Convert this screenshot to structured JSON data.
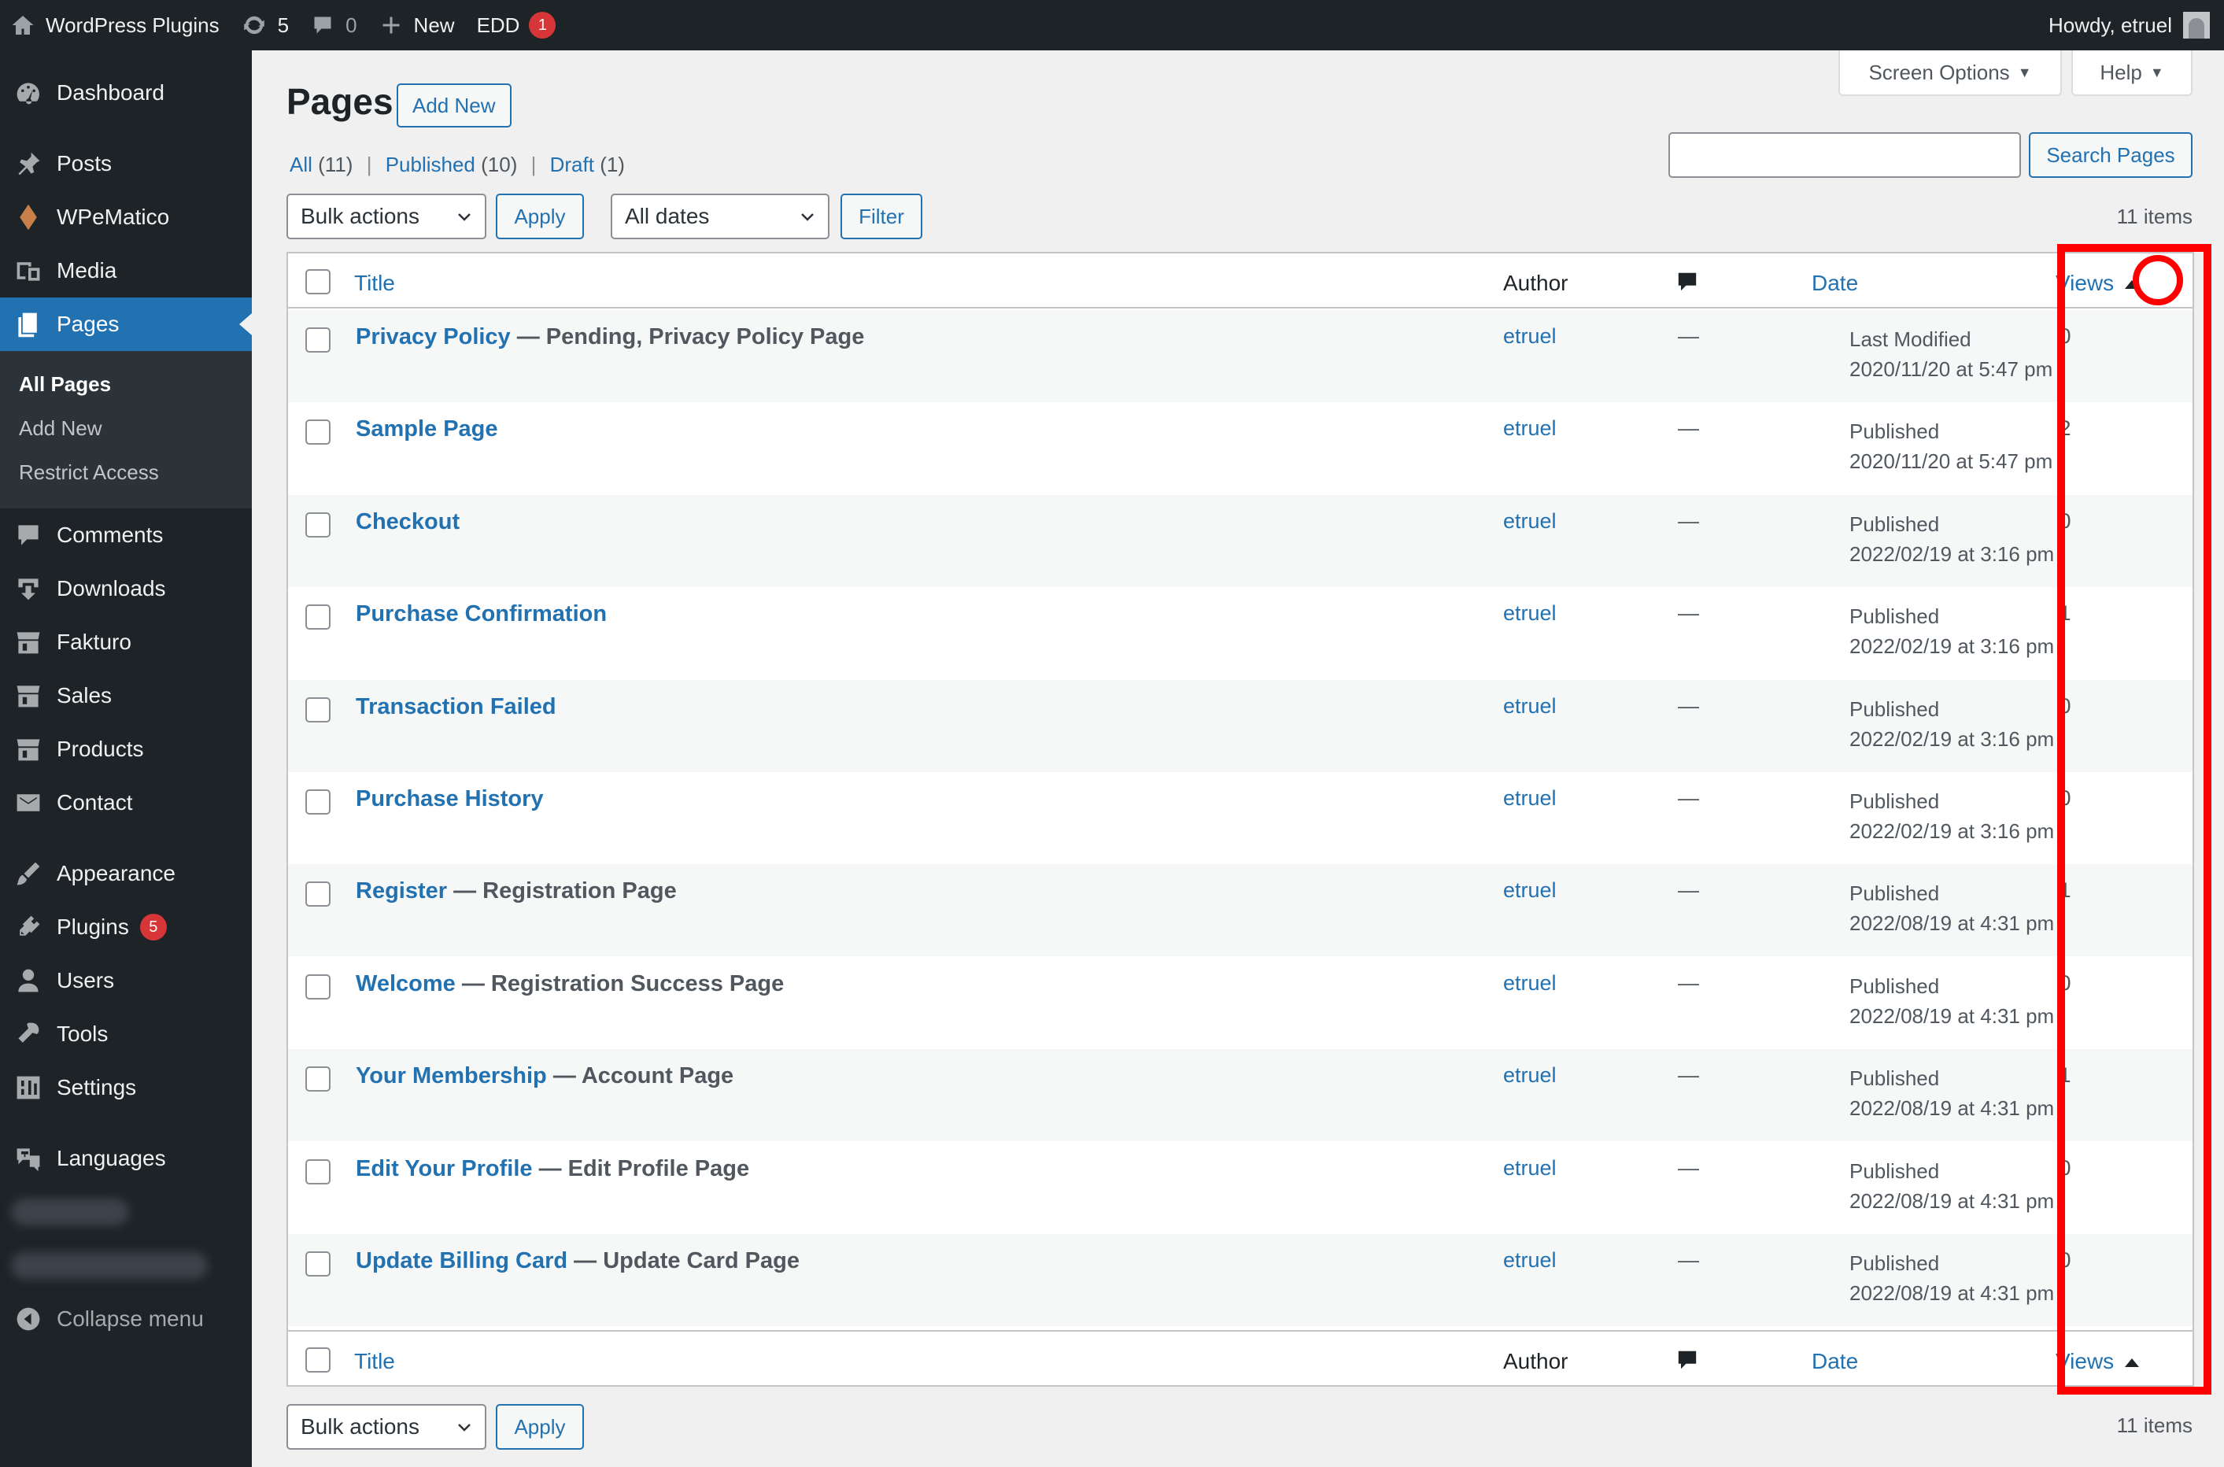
{
  "admin_bar": {
    "site_name": "WordPress Plugins",
    "updates": "5",
    "comments": "0",
    "new_label": "New",
    "edd_label": "EDD",
    "edd_badge": "1",
    "howdy": "Howdy, etruel"
  },
  "sidebar": {
    "dashboard": "Dashboard",
    "posts": "Posts",
    "wpematico": "WPeMatico",
    "media": "Media",
    "pages": "Pages",
    "sub_all_pages": "All Pages",
    "sub_add_new": "Add New",
    "sub_restrict": "Restrict Access",
    "comments": "Comments",
    "downloads": "Downloads",
    "fakturo": "Fakturo",
    "sales": "Sales",
    "products": "Products",
    "contact": "Contact",
    "appearance": "Appearance",
    "plugins": "Plugins",
    "plugins_badge": "5",
    "users": "Users",
    "tools": "Tools",
    "settings": "Settings",
    "languages": "Languages",
    "collapse": "Collapse menu"
  },
  "screen_meta": {
    "screen_options": "Screen Options",
    "help": "Help"
  },
  "header": {
    "title": "Pages",
    "add_new": "Add New"
  },
  "views_filter": {
    "all": "All",
    "all_count": "(11)",
    "published": "Published",
    "published_count": "(10)",
    "draft": "Draft",
    "draft_count": "(1)",
    "sep": "|"
  },
  "search": {
    "button": "Search Pages"
  },
  "tablenav": {
    "bulk_actions": "Bulk actions",
    "apply": "Apply",
    "all_dates": "All dates",
    "filter": "Filter",
    "items": "11 items"
  },
  "table": {
    "col_title": "Title",
    "col_author": "Author",
    "col_date": "Date",
    "col_views": "Views",
    "rows": [
      {
        "title": "Privacy Policy",
        "state": " — Pending, Privacy Policy Page",
        "author": "etruel",
        "comments": "—",
        "status": "Last Modified",
        "date": "2020/11/20 at 5:47 pm",
        "views": "0"
      },
      {
        "title": "Sample Page",
        "state": "",
        "author": "etruel",
        "comments": "—",
        "status": "Published",
        "date": "2020/11/20 at 5:47 pm",
        "views": "2"
      },
      {
        "title": "Checkout",
        "state": "",
        "author": "etruel",
        "comments": "—",
        "status": "Published",
        "date": "2022/02/19 at 3:16 pm",
        "views": "0"
      },
      {
        "title": "Purchase Confirmation",
        "state": "",
        "author": "etruel",
        "comments": "—",
        "status": "Published",
        "date": "2022/02/19 at 3:16 pm",
        "views": "1"
      },
      {
        "title": "Transaction Failed",
        "state": "",
        "author": "etruel",
        "comments": "—",
        "status": "Published",
        "date": "2022/02/19 at 3:16 pm",
        "views": "0"
      },
      {
        "title": "Purchase History",
        "state": "",
        "author": "etruel",
        "comments": "—",
        "status": "Published",
        "date": "2022/02/19 at 3:16 pm",
        "views": "0"
      },
      {
        "title": "Register",
        "state": " — Registration Page",
        "author": "etruel",
        "comments": "—",
        "status": "Published",
        "date": "2022/08/19 at 4:31 pm",
        "views": "1"
      },
      {
        "title": "Welcome",
        "state": " — Registration Success Page",
        "author": "etruel",
        "comments": "—",
        "status": "Published",
        "date": "2022/08/19 at 4:31 pm",
        "views": "0"
      },
      {
        "title": "Your Membership",
        "state": " — Account Page",
        "author": "etruel",
        "comments": "—",
        "status": "Published",
        "date": "2022/08/19 at 4:31 pm",
        "views": "1"
      },
      {
        "title": "Edit Your Profile",
        "state": " — Edit Profile Page",
        "author": "etruel",
        "comments": "—",
        "status": "Published",
        "date": "2022/08/19 at 4:31 pm",
        "views": "0"
      },
      {
        "title": "Update Billing Card",
        "state": " — Update Card Page",
        "author": "etruel",
        "comments": "—",
        "status": "Published",
        "date": "2022/08/19 at 4:31 pm",
        "views": "0"
      }
    ]
  },
  "colors": {
    "admin_dark": "#1d2327",
    "accent_blue": "#2271b1",
    "annotation_red": "#ff0000",
    "badge_red": "#d63638"
  },
  "icons": [
    "home-icon",
    "updates-icon",
    "comment-bubble-icon",
    "plus-icon",
    "dashboard-icon",
    "pin-icon",
    "diamond-icon",
    "media-icon",
    "pages-icon",
    "comments-icon",
    "download-icon",
    "store-icon",
    "envelope-icon",
    "brush-icon",
    "plug-icon",
    "user-icon",
    "wrench-icon",
    "settings-icon",
    "translation-icon",
    "collapse-icon",
    "chevron-down-icon",
    "sort-up-icon"
  ]
}
